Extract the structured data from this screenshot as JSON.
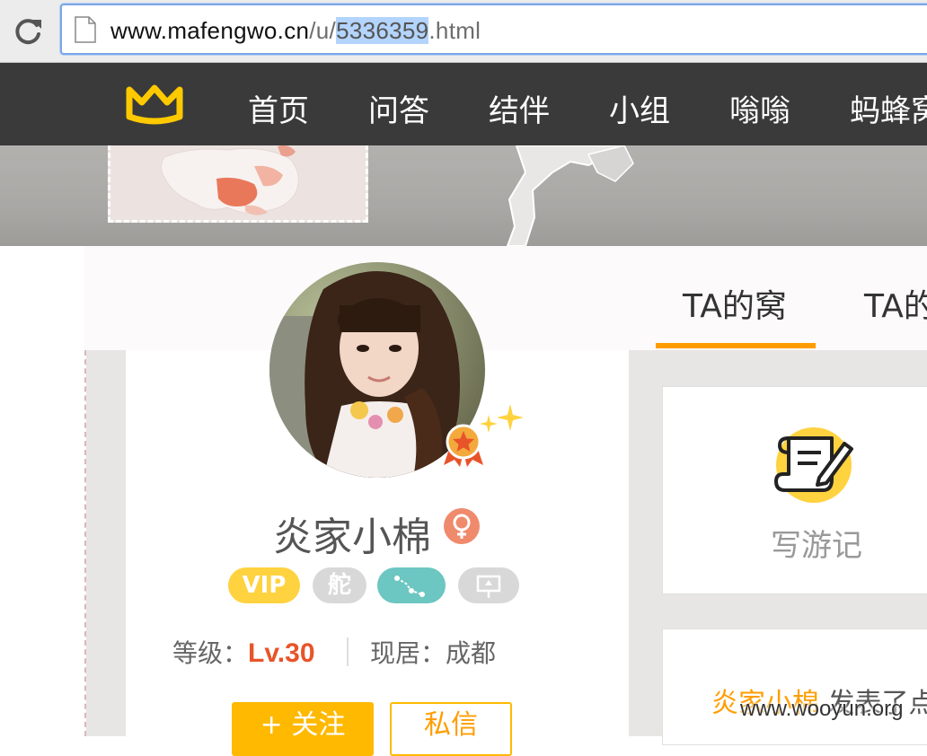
{
  "browser": {
    "url_host": "www.mafengwo.cn",
    "url_path_prefix": "/u/",
    "url_selected": "5336359",
    "url_suffix": ".html"
  },
  "site_nav": {
    "brand_color": "#ffc900",
    "items": [
      "首页",
      "问答",
      "结伴",
      "小组",
      "嗡嗡",
      "蚂蜂窝"
    ]
  },
  "profile_tabs": {
    "items": [
      "TA的窝",
      "TA的"
    ],
    "active_index": 0,
    "accent_color": "#ff9d00"
  },
  "profile": {
    "username": "炎家小棉",
    "gender_icon": "female-icon",
    "badges": [
      "VIP",
      "舵",
      "route-icon",
      "photo-icon"
    ],
    "level_label": "等级：",
    "level_value": "Lv.30",
    "residence_label": "现居：",
    "residence_value": "成都",
    "follow_button": "+ 关注",
    "message_button": "私信"
  },
  "side": {
    "write_travelogue_label": "写游记",
    "feed_author": "炎家小棉",
    "feed_action": "发表了点评"
  },
  "watermark": "www.wooyun.org"
}
